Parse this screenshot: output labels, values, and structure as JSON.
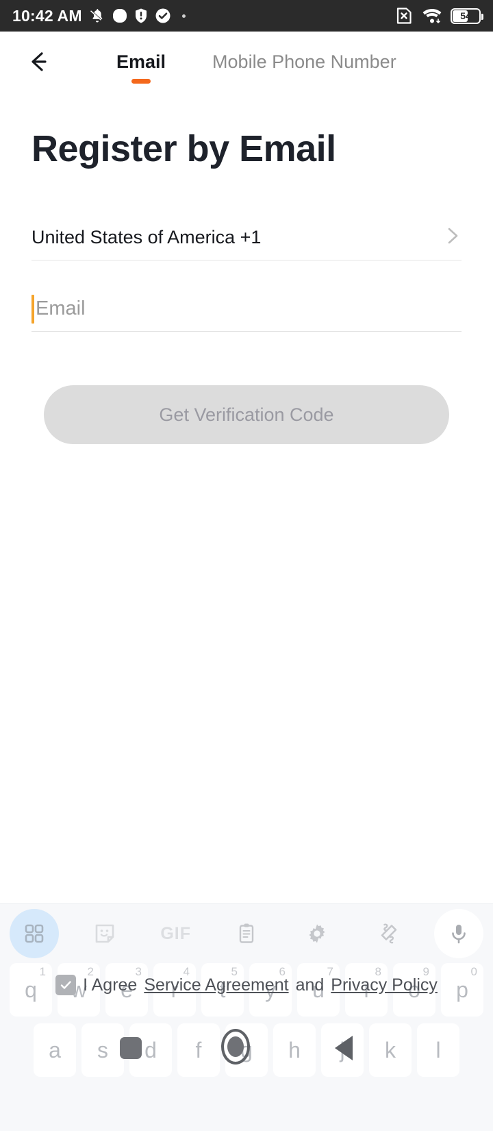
{
  "statusbar": {
    "time": "10:42 AM",
    "battery_level": "54",
    "icons": [
      "mute-bell-icon",
      "rounded-square-icon",
      "shield-icon",
      "check-circle-icon",
      "dot-icon"
    ],
    "right_icons": [
      "sim-card-x-icon",
      "wifi-icon",
      "battery-icon"
    ]
  },
  "header": {
    "back_icon": "back-arrow-icon",
    "tabs": [
      {
        "label": "Email",
        "active": true
      },
      {
        "label": "Mobile Phone Number",
        "active": false
      }
    ],
    "accent_color": "#F4681C"
  },
  "main": {
    "page_title": "Register by Email",
    "country_row": {
      "value": "United States of America +1",
      "chevron": "chevron-right-icon"
    },
    "email_field": {
      "placeholder": "Email",
      "value": "",
      "caret_color": "#F5A42B"
    },
    "cta": {
      "label": "Get Verification Code",
      "enabled": false,
      "bg_color": "#dcdcdc",
      "text_color": "#9a9aa2"
    }
  },
  "agreement": {
    "checked": true,
    "prefix": "I Agree",
    "service_link": "Service Agreement",
    "conjunction": "and",
    "privacy_link": "Privacy Policy"
  },
  "keyboard": {
    "toolbar": [
      {
        "name": "grid-icon",
        "label": "",
        "selected": true
      },
      {
        "name": "sticker-icon",
        "label": "",
        "selected": false
      },
      {
        "name": "gif-icon",
        "label": "GIF",
        "selected": false
      },
      {
        "name": "clipboard-icon",
        "label": "",
        "selected": false
      },
      {
        "name": "gear-icon",
        "label": "",
        "selected": false
      },
      {
        "name": "handwriting-icon",
        "label": "",
        "selected": false
      },
      {
        "name": "microphone-icon",
        "label": "",
        "selected": false
      }
    ],
    "row1": [
      {
        "key": "q",
        "num": "1"
      },
      {
        "key": "w",
        "num": "2"
      },
      {
        "key": "e",
        "num": "3"
      },
      {
        "key": "r",
        "num": "4"
      },
      {
        "key": "t",
        "num": "5"
      },
      {
        "key": "y",
        "num": "6"
      },
      {
        "key": "u",
        "num": "7"
      },
      {
        "key": "i",
        "num": "8"
      },
      {
        "key": "o",
        "num": "9"
      },
      {
        "key": "p",
        "num": "0"
      }
    ],
    "row2": [
      {
        "key": "a"
      },
      {
        "key": "s"
      },
      {
        "key": "d"
      },
      {
        "key": "f"
      },
      {
        "key": "g"
      },
      {
        "key": "h"
      },
      {
        "key": "j"
      },
      {
        "key": "k"
      },
      {
        "key": "l"
      }
    ]
  },
  "navbar": {
    "recents": "square-icon",
    "home": "home-circle-icon",
    "back": "back-triangle-icon"
  }
}
